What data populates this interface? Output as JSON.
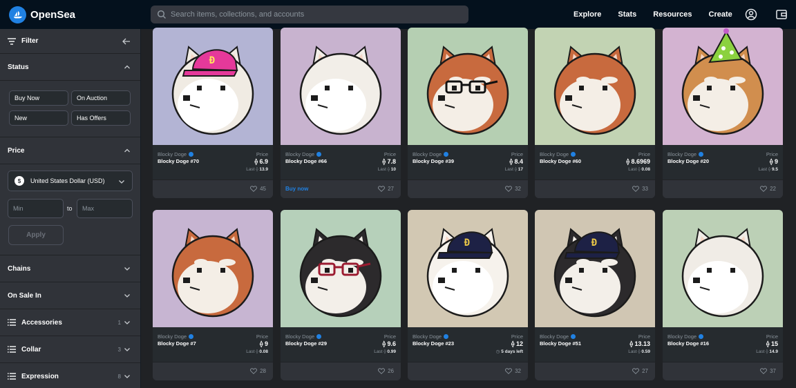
{
  "nav": {
    "brand": "OpenSea",
    "search_placeholder": "Search items, collections, and accounts",
    "links": [
      "Explore",
      "Stats",
      "Resources",
      "Create"
    ]
  },
  "sidebar": {
    "filter_label": "Filter",
    "status": {
      "title": "Status",
      "chips": [
        "Buy Now",
        "On Auction",
        "New",
        "Has Offers"
      ]
    },
    "price": {
      "title": "Price",
      "currency": "United States Dollar (USD)",
      "currency_symbol": "$",
      "min_placeholder": "Min",
      "to_label": "to",
      "max_placeholder": "Max",
      "apply_label": "Apply"
    },
    "sections": [
      {
        "label": "Chains",
        "count": ""
      },
      {
        "label": "On Sale In",
        "count": ""
      },
      {
        "label": "Accessories",
        "count": "1"
      },
      {
        "label": "Collar",
        "count": "3"
      },
      {
        "label": "Expression",
        "count": "8"
      }
    ]
  },
  "cards": [
    {
      "collection": "Blocky Doge",
      "name": "Blocky Doge #70",
      "price_label": "Price",
      "price": "6.9",
      "last_label": "Last",
      "last": "13.9",
      "likes": "45",
      "buy_now": "",
      "bg": "#b3b4d4",
      "fur": "#f0ebe3",
      "hat": "pink",
      "glasses": ""
    },
    {
      "collection": "Blocky Doge",
      "name": "Blocky Doge #66",
      "price_label": "Price",
      "price": "7.8",
      "last_label": "Last",
      "last": "10",
      "likes": "27",
      "buy_now": "Buy now",
      "bg": "#c8b3cf",
      "fur": "#f2eee8",
      "hat": "",
      "glasses": ""
    },
    {
      "collection": "Blocky Doge",
      "name": "Blocky Doge #39",
      "price_label": "Price",
      "price": "8.4",
      "last_label": "Last",
      "last": "17",
      "likes": "32",
      "buy_now": "",
      "bg": "#b5cfb2",
      "fur": "#c86a3e",
      "hat": "",
      "glasses": "black"
    },
    {
      "collection": "Blocky Doge",
      "name": "Blocky Doge #60",
      "price_label": "Price",
      "price": "8.6969",
      "last_label": "Last",
      "last": "0.08",
      "likes": "33",
      "buy_now": "",
      "bg": "#c2d3b3",
      "fur": "#c86a3e",
      "hat": "",
      "glasses": ""
    },
    {
      "collection": "Blocky Doge",
      "name": "Blocky Doge #20",
      "price_label": "Price",
      "price": "9",
      "last_label": "Last",
      "last": "9.5",
      "likes": "22",
      "buy_now": "",
      "bg": "#d3b3d1",
      "fur": "#d18e4e",
      "hat": "party",
      "glasses": ""
    },
    {
      "collection": "Blocky Doge",
      "name": "Blocky Doge #7",
      "price_label": "Price",
      "price": "9",
      "last_label": "Last",
      "last": "0.08",
      "likes": "28",
      "buy_now": "",
      "bg": "#c7b5d2",
      "fur": "#c86a3e",
      "hat": "",
      "glasses": ""
    },
    {
      "collection": "Blocky Doge",
      "name": "Blocky Doge #29",
      "price_label": "Price",
      "price": "9.6",
      "last_label": "Last",
      "last": "0.99",
      "likes": "26",
      "buy_now": "",
      "bg": "#b6d0ba",
      "fur": "#2c2a2c",
      "hat": "",
      "glasses": "red"
    },
    {
      "collection": "Blocky Doge",
      "name": "Blocky Doge #23",
      "price_label": "Price",
      "price": "12",
      "last_label": "",
      "last": "5 days left",
      "likes": "32",
      "buy_now": "",
      "bg": "#d2c8b3",
      "fur": "#f6f2ec",
      "hat": "navy",
      "glasses": ""
    },
    {
      "collection": "Blocky Doge",
      "name": "Blocky Doge #51",
      "price_label": "Price",
      "price": "13.13",
      "last_label": "Last",
      "last": "0.59",
      "likes": "27",
      "buy_now": "",
      "bg": "#d0c6b3",
      "fur": "#2c2a2c",
      "hat": "navy",
      "glasses": ""
    },
    {
      "collection": "Blocky Doge",
      "name": "Blocky Doge #16",
      "price_label": "Price",
      "price": "15",
      "last_label": "Last",
      "last": "14.9",
      "likes": "37",
      "buy_now": "",
      "bg": "#bcd0b6",
      "fur": "#f0ece6",
      "hat": "",
      "glasses": ""
    }
  ],
  "colors": {
    "accent": "#2081e2",
    "nav_bg": "#04111d",
    "panel": "#303339"
  },
  "icons": {
    "eth": "eth-icon",
    "heart": "heart-icon",
    "verified": "verified-badge-icon",
    "clock": "clock-icon"
  }
}
